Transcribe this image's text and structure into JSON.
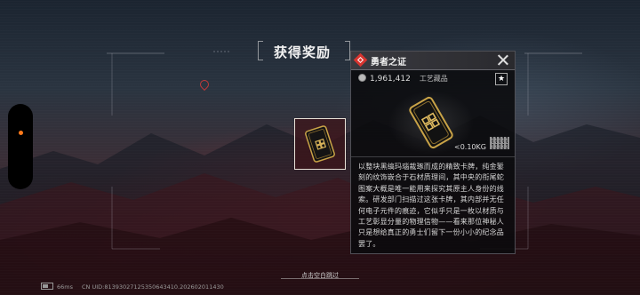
{
  "screen": {
    "title": "获得奖励",
    "hint": "点击空白跳过"
  },
  "tooltip": {
    "name": "勇者之证",
    "price": "1,961,412",
    "category": "工艺藏品",
    "star_icon": "★",
    "weight": "<0.10KG",
    "description": "以整块黑缟玛瑙裁琢而成的精致卡牌，纯金錾刻的纹饰嵌合于石材质理间，其中央的衔尾蛇图案大概是唯一能用来探究其原主人身份的线索。研发部门扫描过这张卡牌，其内部并无任何电子元件的痕迹，它似乎只是一枚以材质与工艺彰显分量的物理信物——看来那位神秘人只是想给真正的勇士们留下一份小小的纪念品罢了。"
  },
  "status_bar": {
    "latency": "66ms",
    "uid": "CN UID:81393027125350643410.202602011430"
  },
  "colors": {
    "accent_red": "#d8342f",
    "notice_orange": "#ff7a1a",
    "card_gold": "#c9a347"
  }
}
